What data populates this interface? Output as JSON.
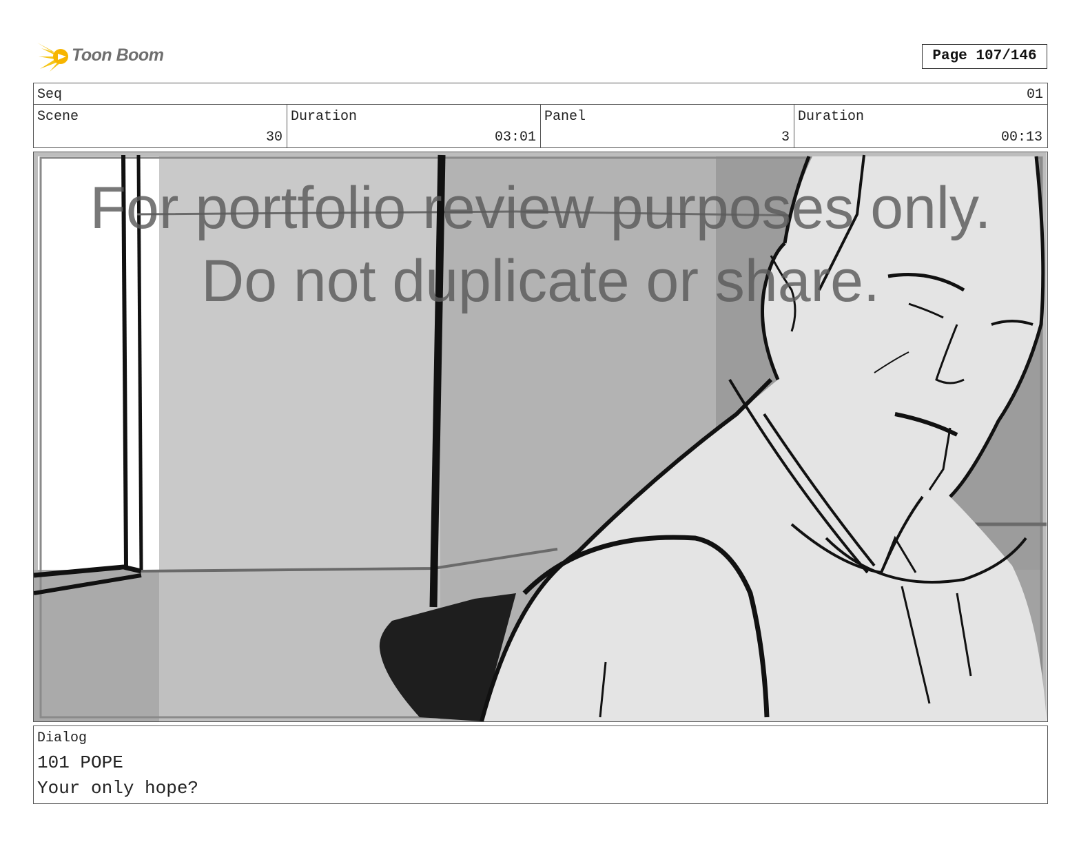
{
  "header": {
    "logo_text": "Toon Boom",
    "page_label": "Page 107/146"
  },
  "info": {
    "seq_label": "Seq",
    "seq_value": "01",
    "scene_label": "Scene",
    "scene_value": "30",
    "scene_duration_label": "Duration",
    "scene_duration_value": "03:01",
    "panel_label": "Panel",
    "panel_value": "3",
    "panel_duration_label": "Duration",
    "panel_duration_value": "00:13"
  },
  "watermark": {
    "line1": "For portfolio review purposes only.",
    "line2": "Do not duplicate or share."
  },
  "dialog": {
    "label": "Dialog",
    "line1": "101 POPE",
    "line2": "Your only hope?"
  },
  "colors": {
    "logo_accent": "#f5c518",
    "logo_text": "#6f6f6f",
    "border": "#555555"
  }
}
